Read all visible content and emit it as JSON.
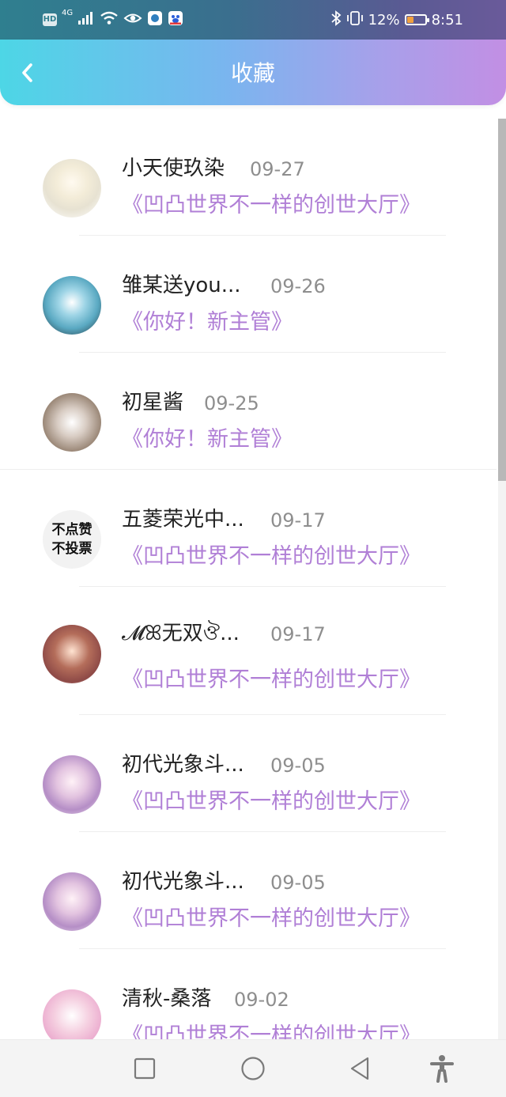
{
  "status_bar": {
    "hd_label": "HD",
    "network_label": "4G",
    "battery_percent": "12%",
    "time": "8:51",
    "battery_level": 0.12,
    "icons": [
      "wifi-icon",
      "eye-icon",
      "app-icon",
      "baidu-icon",
      "bluetooth-icon",
      "vibrate-icon"
    ]
  },
  "header": {
    "title": "收藏",
    "back_icon": "chevron-left-icon"
  },
  "items": [
    {
      "name": "小天使玖染",
      "date": "09-27",
      "title": "《凹凸世界不一样的创世大厅》",
      "avatar_text": []
    },
    {
      "name": "雏某送you...",
      "date": "09-26",
      "title": "《你好！新主管》",
      "avatar_text": []
    },
    {
      "name": "初星酱",
      "date": "09-25",
      "title": "《你好！新主管》",
      "avatar_text": []
    },
    {
      "name": "五菱荣光中...",
      "date": "09-17",
      "title": "《凹凸世界不一样的创世大厅》",
      "avatar_text": [
        "不点赞",
        "不投票"
      ]
    },
    {
      "name": "𝓜ꕤ无双ঔ...",
      "date": "09-17",
      "title": "《凹凸世界不一样的创世大厅》",
      "avatar_text": []
    },
    {
      "name": "初代光象斗...",
      "date": "09-05",
      "title": "《凹凸世界不一样的创世大厅》",
      "avatar_text": []
    },
    {
      "name": "初代光象斗...",
      "date": "09-05",
      "title": "《凹凸世界不一样的创世大厅》",
      "avatar_text": []
    },
    {
      "name": "清秋-桑落",
      "date": "09-02",
      "title": "《凹凸世界不一样的创世大厅》",
      "avatar_text": []
    }
  ],
  "nav_bar": {
    "icons": [
      "recent-apps-icon",
      "home-icon",
      "back-triangle-icon",
      "accessibility-icon"
    ]
  },
  "colors": {
    "accent_purple": "#b07fd6",
    "header_gradient_start": "#4dd6e6",
    "header_gradient_end": "#c28fe4"
  }
}
